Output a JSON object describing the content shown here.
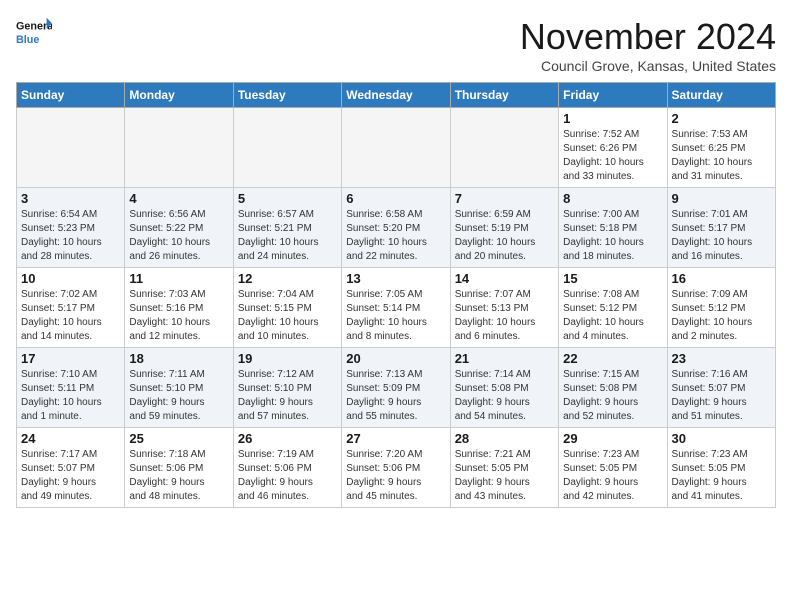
{
  "logo": {
    "line1": "General",
    "line2": "Blue"
  },
  "title": "November 2024",
  "location": "Council Grove, Kansas, United States",
  "days_of_week": [
    "Sunday",
    "Monday",
    "Tuesday",
    "Wednesday",
    "Thursday",
    "Friday",
    "Saturday"
  ],
  "weeks": [
    [
      {
        "day": "",
        "info": ""
      },
      {
        "day": "",
        "info": ""
      },
      {
        "day": "",
        "info": ""
      },
      {
        "day": "",
        "info": ""
      },
      {
        "day": "",
        "info": ""
      },
      {
        "day": "1",
        "info": "Sunrise: 7:52 AM\nSunset: 6:26 PM\nDaylight: 10 hours\nand 33 minutes."
      },
      {
        "day": "2",
        "info": "Sunrise: 7:53 AM\nSunset: 6:25 PM\nDaylight: 10 hours\nand 31 minutes."
      }
    ],
    [
      {
        "day": "3",
        "info": "Sunrise: 6:54 AM\nSunset: 5:23 PM\nDaylight: 10 hours\nand 28 minutes."
      },
      {
        "day": "4",
        "info": "Sunrise: 6:56 AM\nSunset: 5:22 PM\nDaylight: 10 hours\nand 26 minutes."
      },
      {
        "day": "5",
        "info": "Sunrise: 6:57 AM\nSunset: 5:21 PM\nDaylight: 10 hours\nand 24 minutes."
      },
      {
        "day": "6",
        "info": "Sunrise: 6:58 AM\nSunset: 5:20 PM\nDaylight: 10 hours\nand 22 minutes."
      },
      {
        "day": "7",
        "info": "Sunrise: 6:59 AM\nSunset: 5:19 PM\nDaylight: 10 hours\nand 20 minutes."
      },
      {
        "day": "8",
        "info": "Sunrise: 7:00 AM\nSunset: 5:18 PM\nDaylight: 10 hours\nand 18 minutes."
      },
      {
        "day": "9",
        "info": "Sunrise: 7:01 AM\nSunset: 5:17 PM\nDaylight: 10 hours\nand 16 minutes."
      }
    ],
    [
      {
        "day": "10",
        "info": "Sunrise: 7:02 AM\nSunset: 5:17 PM\nDaylight: 10 hours\nand 14 minutes."
      },
      {
        "day": "11",
        "info": "Sunrise: 7:03 AM\nSunset: 5:16 PM\nDaylight: 10 hours\nand 12 minutes."
      },
      {
        "day": "12",
        "info": "Sunrise: 7:04 AM\nSunset: 5:15 PM\nDaylight: 10 hours\nand 10 minutes."
      },
      {
        "day": "13",
        "info": "Sunrise: 7:05 AM\nSunset: 5:14 PM\nDaylight: 10 hours\nand 8 minutes."
      },
      {
        "day": "14",
        "info": "Sunrise: 7:07 AM\nSunset: 5:13 PM\nDaylight: 10 hours\nand 6 minutes."
      },
      {
        "day": "15",
        "info": "Sunrise: 7:08 AM\nSunset: 5:12 PM\nDaylight: 10 hours\nand 4 minutes."
      },
      {
        "day": "16",
        "info": "Sunrise: 7:09 AM\nSunset: 5:12 PM\nDaylight: 10 hours\nand 2 minutes."
      }
    ],
    [
      {
        "day": "17",
        "info": "Sunrise: 7:10 AM\nSunset: 5:11 PM\nDaylight: 10 hours\nand 1 minute."
      },
      {
        "day": "18",
        "info": "Sunrise: 7:11 AM\nSunset: 5:10 PM\nDaylight: 9 hours\nand 59 minutes."
      },
      {
        "day": "19",
        "info": "Sunrise: 7:12 AM\nSunset: 5:10 PM\nDaylight: 9 hours\nand 57 minutes."
      },
      {
        "day": "20",
        "info": "Sunrise: 7:13 AM\nSunset: 5:09 PM\nDaylight: 9 hours\nand 55 minutes."
      },
      {
        "day": "21",
        "info": "Sunrise: 7:14 AM\nSunset: 5:08 PM\nDaylight: 9 hours\nand 54 minutes."
      },
      {
        "day": "22",
        "info": "Sunrise: 7:15 AM\nSunset: 5:08 PM\nDaylight: 9 hours\nand 52 minutes."
      },
      {
        "day": "23",
        "info": "Sunrise: 7:16 AM\nSunset: 5:07 PM\nDaylight: 9 hours\nand 51 minutes."
      }
    ],
    [
      {
        "day": "24",
        "info": "Sunrise: 7:17 AM\nSunset: 5:07 PM\nDaylight: 9 hours\nand 49 minutes."
      },
      {
        "day": "25",
        "info": "Sunrise: 7:18 AM\nSunset: 5:06 PM\nDaylight: 9 hours\nand 48 minutes."
      },
      {
        "day": "26",
        "info": "Sunrise: 7:19 AM\nSunset: 5:06 PM\nDaylight: 9 hours\nand 46 minutes."
      },
      {
        "day": "27",
        "info": "Sunrise: 7:20 AM\nSunset: 5:06 PM\nDaylight: 9 hours\nand 45 minutes."
      },
      {
        "day": "28",
        "info": "Sunrise: 7:21 AM\nSunset: 5:05 PM\nDaylight: 9 hours\nand 43 minutes."
      },
      {
        "day": "29",
        "info": "Sunrise: 7:23 AM\nSunset: 5:05 PM\nDaylight: 9 hours\nand 42 minutes."
      },
      {
        "day": "30",
        "info": "Sunrise: 7:23 AM\nSunset: 5:05 PM\nDaylight: 9 hours\nand 41 minutes."
      }
    ]
  ]
}
